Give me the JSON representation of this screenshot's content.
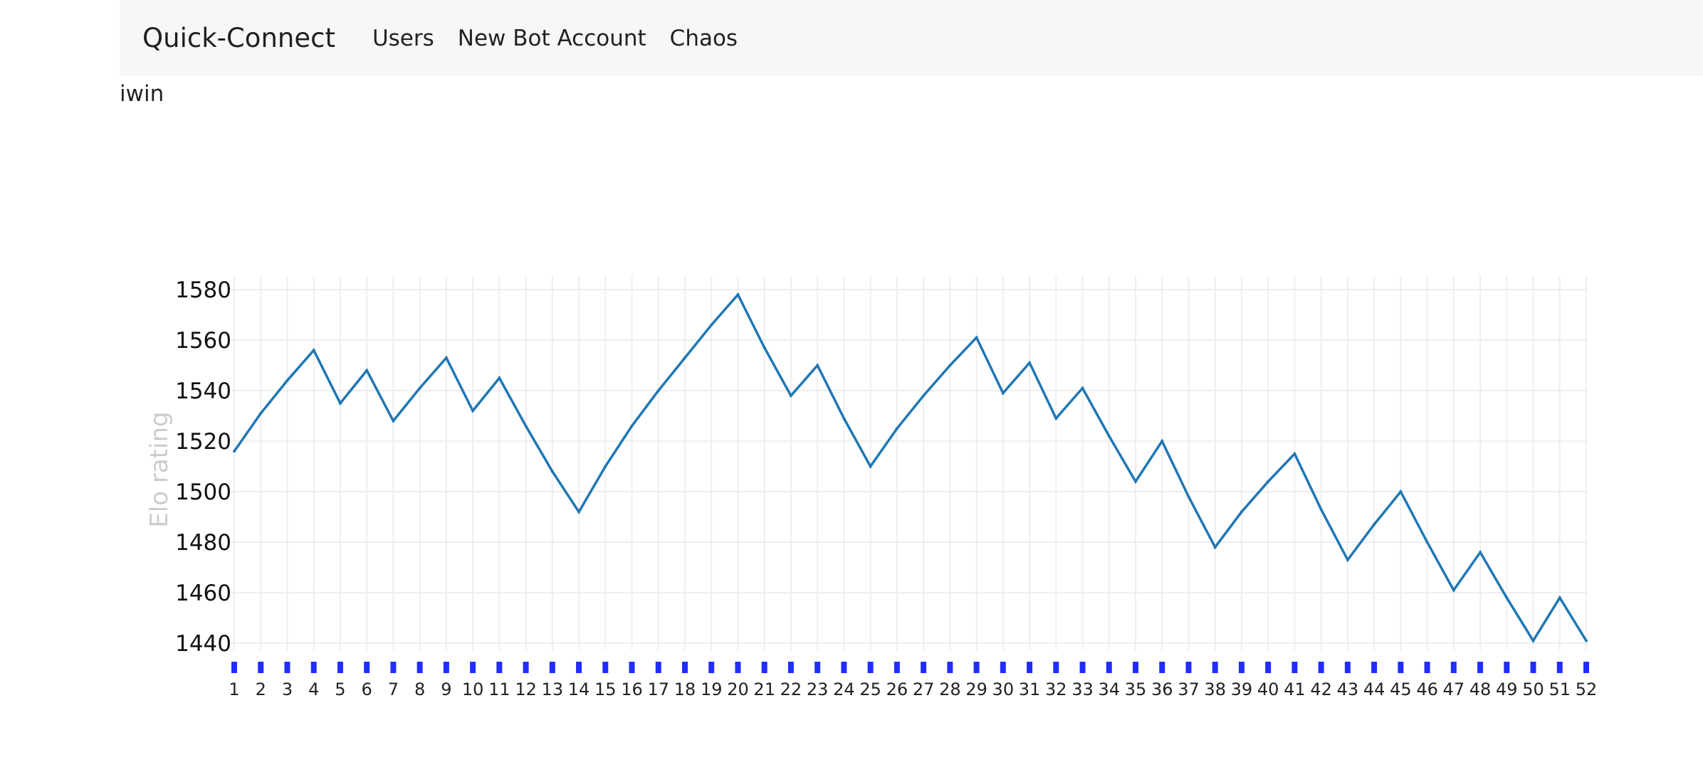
{
  "navbar": {
    "brand": "Quick-Connect",
    "links": [
      "Users",
      "New Bot Account",
      "Chaos"
    ]
  },
  "user": {
    "name": "iwin"
  },
  "colors": {
    "line": "#1f77b4",
    "ticks": "#1f2eff",
    "grid": "#eeeeee",
    "ylabel": "#cccccc"
  },
  "chart_data": {
    "type": "line",
    "ylabel": "Elo rating",
    "xlabel": "",
    "title": "",
    "ylim": [
      1434,
      1585
    ],
    "yticks": [
      1440,
      1460,
      1480,
      1500,
      1520,
      1540,
      1560,
      1580
    ],
    "grid": true,
    "x": [
      1,
      2,
      3,
      4,
      5,
      6,
      7,
      8,
      9,
      10,
      11,
      12,
      13,
      14,
      15,
      16,
      17,
      18,
      19,
      20,
      21,
      22,
      23,
      24,
      25,
      26,
      27,
      28,
      29,
      30,
      31,
      32,
      33,
      34,
      35,
      36,
      37,
      38,
      39,
      40,
      41,
      42,
      43,
      44,
      45,
      46,
      47,
      48,
      49,
      50,
      51,
      52
    ],
    "series": [
      {
        "name": "",
        "values": [
          1516,
          1531,
          1544,
          1556,
          1535,
          1548,
          1528,
          1541,
          1553,
          1532,
          1545,
          1526,
          1508,
          1492,
          1510,
          1526,
          1540,
          1553,
          1566,
          1578,
          1557,
          1538,
          1550,
          1529,
          1510,
          1525,
          1538,
          1550,
          1561,
          1539,
          1551,
          1529,
          1541,
          1522,
          1504,
          1520,
          1498,
          1478,
          1492,
          1504,
          1515,
          1493,
          1473,
          1487,
          1500,
          1480,
          1461,
          1476,
          1458,
          1441,
          1458,
          1441
        ]
      }
    ]
  }
}
